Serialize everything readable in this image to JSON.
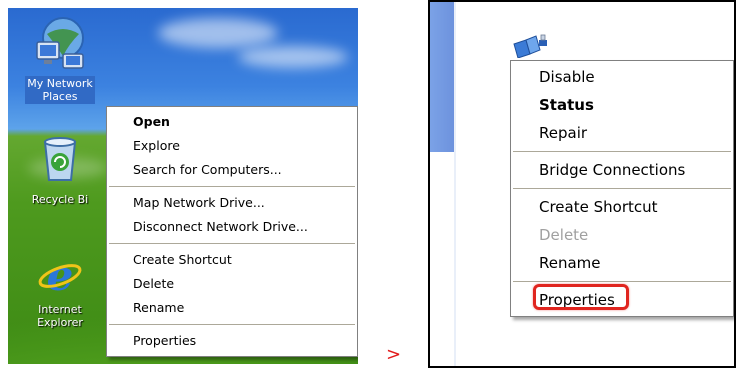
{
  "desktop": {
    "icons": [
      {
        "label_line1": "My Network",
        "label_line2": "Places",
        "icon": "network-places-icon"
      },
      {
        "label_line1": "Recycle Bi",
        "label_line2": "",
        "icon": "recycle-bin-icon"
      },
      {
        "label_line1": "Internet",
        "label_line2": "Explorer",
        "icon": "internet-explorer-icon"
      }
    ]
  },
  "network_places_menu": {
    "items": [
      {
        "label": "Open"
      },
      {
        "label": "Explore"
      },
      {
        "label": "Search for Computers..."
      },
      {
        "label": "Map Network Drive..."
      },
      {
        "label": "Disconnect Network Drive..."
      },
      {
        "label": "Create Shortcut"
      },
      {
        "label": "Delete"
      },
      {
        "label": "Rename"
      },
      {
        "label": "Properties"
      }
    ]
  },
  "arrow": ">",
  "connection_menu": {
    "icon": "network-connection-icon",
    "items": [
      {
        "label": "Disable"
      },
      {
        "label": "Status"
      },
      {
        "label": "Repair"
      },
      {
        "label": "Bridge Connections"
      },
      {
        "label": "Create Shortcut"
      },
      {
        "label": "Delete"
      },
      {
        "label": "Rename"
      },
      {
        "label": "Properties"
      }
    ]
  },
  "colors": {
    "selection": "#316ac5",
    "highlight": "#e0251f",
    "arrow": "#e21b1b"
  }
}
